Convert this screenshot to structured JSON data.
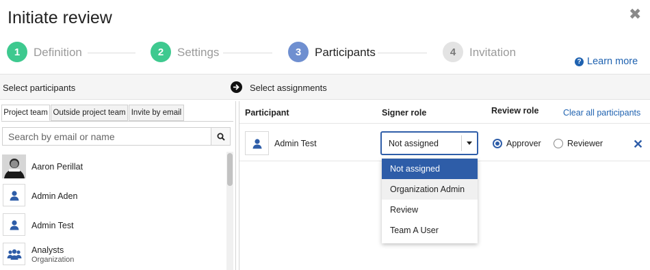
{
  "dialog": {
    "title": "Initiate review",
    "close_icon": "close-icon"
  },
  "steps": [
    {
      "number": "1",
      "label": "Definition",
      "color": "#3ec98f",
      "label_color": "#9a9a9a"
    },
    {
      "number": "2",
      "label": "Settings",
      "color": "#3ec98f",
      "label_color": "#9a9a9a"
    },
    {
      "number": "3",
      "label": "Participants",
      "color": "#6f8fd0",
      "label_color": "#222222"
    },
    {
      "number": "4",
      "label": "Invitation",
      "color": "#e3e3e3",
      "label_color": "#9a9a9a"
    }
  ],
  "learn_more": {
    "label": "Learn more",
    "icon": "help-icon"
  },
  "left": {
    "header": "Select participants",
    "tabs": [
      "Project team",
      "Outside project team",
      "Invite by email"
    ],
    "search_placeholder": "Search by email or name",
    "people": [
      {
        "name": "Aaron Perillat",
        "sub": "",
        "avatar": "photo"
      },
      {
        "name": "Admin Aden",
        "sub": "",
        "avatar": "user-icon"
      },
      {
        "name": "Admin Test",
        "sub": "",
        "avatar": "user-icon"
      },
      {
        "name": "Analysts",
        "sub": "Organization",
        "avatar": "group-icon"
      }
    ]
  },
  "right": {
    "header": "Select assignments",
    "columns": {
      "participant": "Participant",
      "signer_role": "Signer role",
      "review_role": "Review role"
    },
    "clear_all": "Clear all participants",
    "row": {
      "name": "Admin Test",
      "signer_role": "Not assigned",
      "review_role_options": [
        "Approver",
        "Reviewer"
      ],
      "review_role_selected": "Approver"
    },
    "dropdown_options": [
      "Not assigned",
      "Organization Admin",
      "Review",
      "Team A User"
    ],
    "dropdown_selected": "Not assigned",
    "dropdown_hovered": "Organization Admin"
  },
  "colors": {
    "accent": "#2e5da8",
    "link": "#1f62b0",
    "selected_option": "#2e5da8",
    "hover_option": "#f0f0f0"
  }
}
